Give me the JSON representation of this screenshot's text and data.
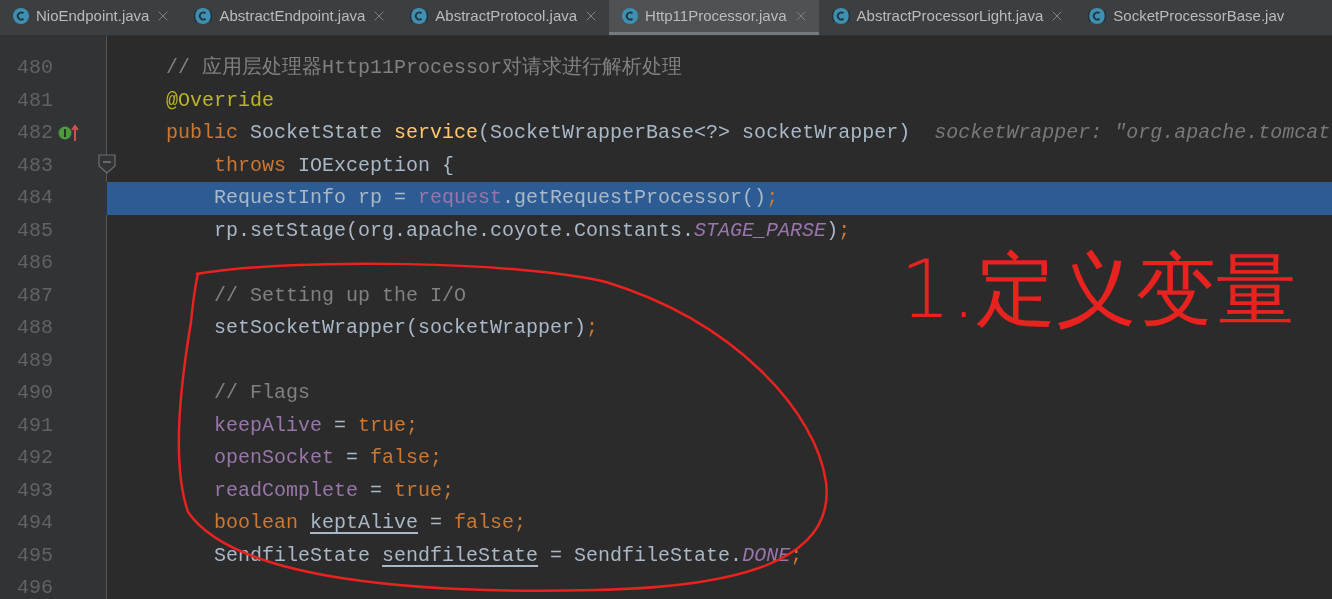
{
  "tabs": [
    {
      "label": "NioEndpoint.java",
      "kind": "class",
      "selected": false,
      "closable": true
    },
    {
      "label": "AbstractEndpoint.java",
      "kind": "abstract",
      "selected": false,
      "closable": true
    },
    {
      "label": "AbstractProtocol.java",
      "kind": "abstract",
      "selected": false,
      "closable": true
    },
    {
      "label": "Http11Processor.java",
      "kind": "class",
      "selected": true,
      "closable": true
    },
    {
      "label": "AbstractProcessorLight.java",
      "kind": "abstract",
      "selected": false,
      "closable": true
    },
    {
      "label": "SocketProcessorBase.jav",
      "kind": "abstract",
      "selected": false,
      "closable": false
    }
  ],
  "editor": {
    "lines": [
      {
        "number": "480",
        "selected": false,
        "kind": "plain",
        "tokens": [
          {
            "kind": "comment",
            "text": "    // 应用层处理器Http11Processor对请求进行解析处理"
          }
        ]
      },
      {
        "number": "481",
        "selected": false,
        "kind": "plain",
        "tokens": [
          {
            "kind": "annotation",
            "text": "    @Override"
          }
        ]
      },
      {
        "number": "482",
        "selected": false,
        "kind": "implements",
        "tokens": [
          {
            "kind": "keyword",
            "text": "    public"
          },
          {
            "kind": "plain",
            "text": " SocketState "
          },
          {
            "kind": "method",
            "text": "service"
          },
          {
            "kind": "plain",
            "text": "(SocketWrapperBase<?> socketWrapper)"
          }
        ],
        "hint": "socketWrapper: \"org.apache.tomcat"
      },
      {
        "number": "483",
        "selected": false,
        "kind": "fold",
        "tokens": [
          {
            "kind": "keyword",
            "text": "        throws"
          },
          {
            "kind": "plain",
            "text": " IOException {"
          }
        ]
      },
      {
        "number": "484",
        "selected": true,
        "kind": "plain",
        "tokens": [
          {
            "kind": "plain",
            "text": "        RequestInfo rp = "
          },
          {
            "kind": "field",
            "text": "request"
          },
          {
            "kind": "plain",
            "text": ".getRequestProcessor()"
          },
          {
            "kind": "punct",
            "text": ";"
          }
        ]
      },
      {
        "number": "485",
        "selected": false,
        "kind": "plain",
        "tokens": [
          {
            "kind": "plain",
            "text": "        rp.setStage(org.apache.coyote.Constants."
          },
          {
            "kind": "static",
            "text": "STAGE_PARSE"
          },
          {
            "kind": "plain",
            "text": ")"
          },
          {
            "kind": "punct",
            "text": ";"
          }
        ]
      },
      {
        "number": "486",
        "selected": false,
        "kind": "plain"
      },
      {
        "number": "487",
        "selected": false,
        "kind": "plain",
        "tokens": [
          {
            "kind": "comment",
            "text": "        // Setting up the I/O"
          }
        ]
      },
      {
        "number": "488",
        "selected": false,
        "kind": "plain",
        "tokens": [
          {
            "kind": "plain",
            "text": "        setSocketWrapper(socketWrapper)"
          },
          {
            "kind": "punct",
            "text": ";"
          }
        ]
      },
      {
        "number": "489",
        "selected": false,
        "kind": "plain"
      },
      {
        "number": "490",
        "selected": false,
        "kind": "plain",
        "tokens": [
          {
            "kind": "comment",
            "text": "        // Flags"
          }
        ]
      },
      {
        "number": "491",
        "selected": false,
        "kind": "plain",
        "tokens": [
          {
            "kind": "field",
            "text": "        keepAlive"
          },
          {
            "kind": "plain",
            "text": " = "
          },
          {
            "kind": "keyword",
            "text": "true"
          },
          {
            "kind": "punct",
            "text": ";"
          }
        ]
      },
      {
        "number": "492",
        "selected": false,
        "kind": "plain",
        "tokens": [
          {
            "kind": "field",
            "text": "        openSocket"
          },
          {
            "kind": "plain",
            "text": " = "
          },
          {
            "kind": "keyword",
            "text": "false"
          },
          {
            "kind": "punct",
            "text": ";"
          }
        ]
      },
      {
        "number": "493",
        "selected": false,
        "kind": "plain",
        "tokens": [
          {
            "kind": "field",
            "text": "        readComplete"
          },
          {
            "kind": "plain",
            "text": " = "
          },
          {
            "kind": "keyword",
            "text": "true"
          },
          {
            "kind": "punct",
            "text": ";"
          }
        ]
      },
      {
        "number": "494",
        "selected": false,
        "kind": "plain",
        "tokens": [
          {
            "kind": "keyword",
            "text": "        boolean "
          },
          {
            "kind": "reassigned",
            "text": "keptAlive"
          },
          {
            "kind": "plain",
            "text": " = "
          },
          {
            "kind": "keyword",
            "text": "false"
          },
          {
            "kind": "punct",
            "text": ";"
          }
        ]
      },
      {
        "number": "495",
        "selected": false,
        "kind": "plain",
        "tokens": [
          {
            "kind": "plain",
            "text": "        SendfileState "
          },
          {
            "kind": "reassigned",
            "text": "sendfileState"
          },
          {
            "kind": "plain",
            "text": " = SendfileState."
          },
          {
            "kind": "static",
            "text": "DONE"
          },
          {
            "kind": "punct",
            "text": ";"
          }
        ]
      },
      {
        "number": "496",
        "selected": false,
        "kind": "plain"
      }
    ]
  },
  "annotation": {
    "text": "1.定义变量"
  }
}
